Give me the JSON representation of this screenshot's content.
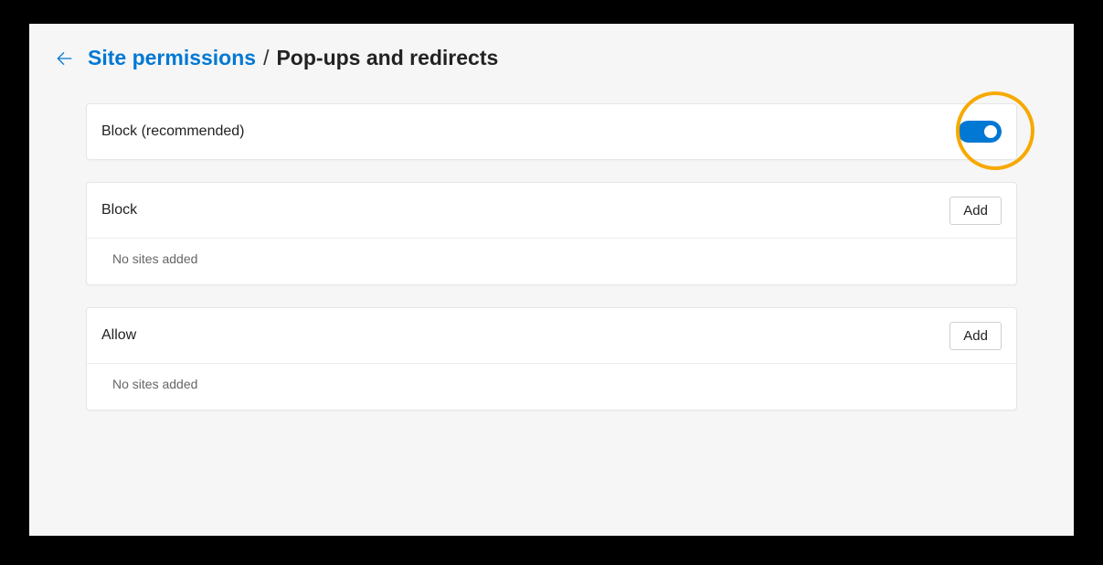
{
  "breadcrumb": {
    "parent": "Site permissions",
    "separator": "/",
    "current": "Pop-ups and redirects"
  },
  "main_toggle": {
    "label": "Block (recommended)",
    "state": "on"
  },
  "block_section": {
    "title": "Block",
    "add_label": "Add",
    "empty_text": "No sites added"
  },
  "allow_section": {
    "title": "Allow",
    "add_label": "Add",
    "empty_text": "No sites added"
  }
}
